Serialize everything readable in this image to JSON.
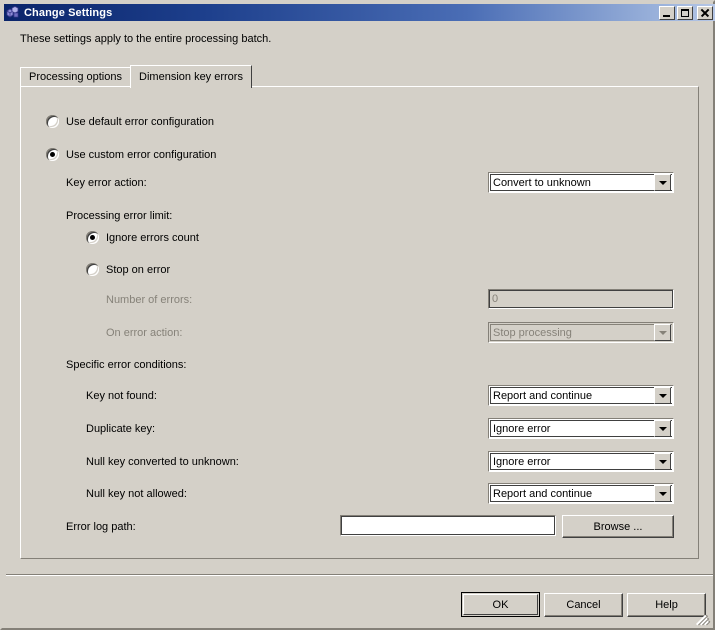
{
  "window": {
    "title": "Change Settings",
    "icon": "cube-settings-icon",
    "controls": {
      "minimize": "Minimize",
      "maximize": "Maximize",
      "close": "Close"
    }
  },
  "intro_text": "These settings apply to the entire processing batch.",
  "tabs": [
    {
      "label": "Processing options",
      "active": false
    },
    {
      "label": "Dimension key errors",
      "active": true
    }
  ],
  "config_mode": {
    "default_option": "Use default error configuration",
    "custom_option": "Use custom error configuration",
    "selected": "custom"
  },
  "key_error_action": {
    "label": "Key error action:",
    "value": "Convert to unknown"
  },
  "processing_error_limit": {
    "label": "Processing error limit:",
    "ignore_option": "Ignore errors count",
    "stop_option": "Stop on error",
    "selected": "ignore",
    "number_of_errors": {
      "label": "Number of errors:",
      "value": "0",
      "disabled": true
    },
    "on_error_action": {
      "label": "On error action:",
      "value": "Stop processing",
      "disabled": true
    }
  },
  "specific_error_conditions": {
    "label": "Specific error conditions:",
    "rows": [
      {
        "label": "Key not found:",
        "value": "Report and continue"
      },
      {
        "label": "Duplicate key:",
        "value": "Ignore error"
      },
      {
        "label": "Null key converted to unknown:",
        "value": "Ignore error"
      },
      {
        "label": "Null key not allowed:",
        "value": "Report and continue"
      }
    ]
  },
  "error_log": {
    "label": "Error log path:",
    "value": "",
    "placeholder": "",
    "browse_label": "Browse ..."
  },
  "footer_buttons": {
    "ok": "OK",
    "cancel": "Cancel",
    "help": "Help"
  },
  "colors": {
    "face": "#d4d0c8",
    "title_start": "#0a246a",
    "title_end": "#b6c7e6",
    "disabled_text": "#868279"
  }
}
